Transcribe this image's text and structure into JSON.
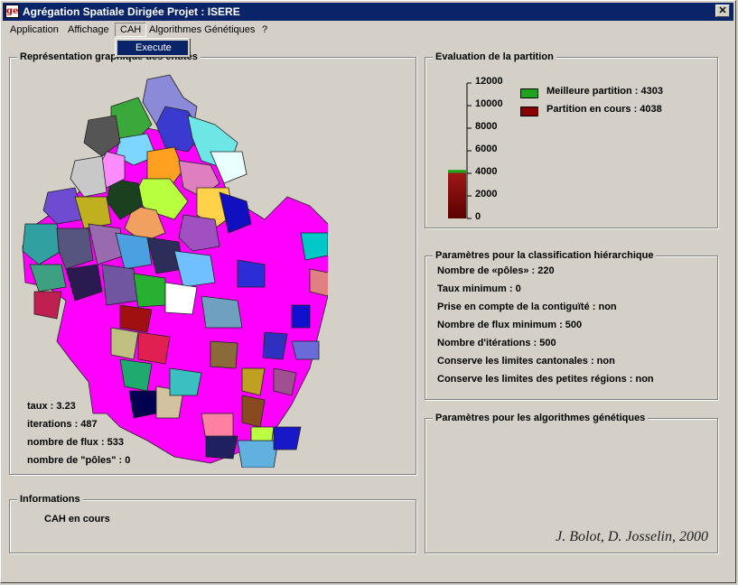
{
  "window": {
    "app_icon_text": "ge",
    "title": "Agrégation Spatiale Dirigée  Projet : ISERE",
    "close_glyph": "✕"
  },
  "menu": {
    "items": [
      "Application",
      "Affichage",
      "CAH",
      "Algorithmes Génétiques",
      "?"
    ],
    "open_dropdown": {
      "items": [
        "Execute"
      ]
    }
  },
  "map_panel": {
    "label": "Représentation graphique des entités",
    "stats": [
      "taux : 3.23",
      "iterations : 487",
      "nombre de flux : 533",
      "nombre de \"pôles\" : 0"
    ]
  },
  "colors": {
    "magenta": "#ff00ff",
    "best_partition": "#1fa31f",
    "current_partition": "#8b0000",
    "titlebar": "#0a246a"
  },
  "info_panel": {
    "label": "Informations",
    "message": "CAH en cours"
  },
  "evaluation_panel": {
    "label": "Evaluation de la partition",
    "ticks": [
      "12000",
      "10000",
      "8000",
      "6000",
      "4000",
      "2000",
      "0"
    ],
    "legend": [
      {
        "label": "Meilleure partition : 4303",
        "color": "#1fa31f"
      },
      {
        "label": "Partition en cours : 4038",
        "color": "#8b0000"
      }
    ]
  },
  "chart_data": {
    "type": "bar",
    "categories": [
      "Meilleure partition",
      "Partition en cours"
    ],
    "values": [
      4303,
      4038
    ],
    "ylim": [
      0,
      12000
    ],
    "grid": false,
    "legend_position": "right"
  },
  "hier_panel": {
    "label": "Paramètres pour la classification hiérarchique",
    "params": [
      "Nombre de «pôles» : 220",
      "Taux minimum : 0",
      "Prise en compte de la contiguïté : non",
      "Nombre de flux minimum : 500",
      "Nombre d'itérations : 500",
      "Conserve les limites cantonales : non",
      "Conserve les limites des petites régions : non"
    ]
  },
  "genetic_panel": {
    "label": "Paramètres pour les algorithmes génétiques",
    "credit": "J. Bolot, D. Josselin, 2000"
  }
}
